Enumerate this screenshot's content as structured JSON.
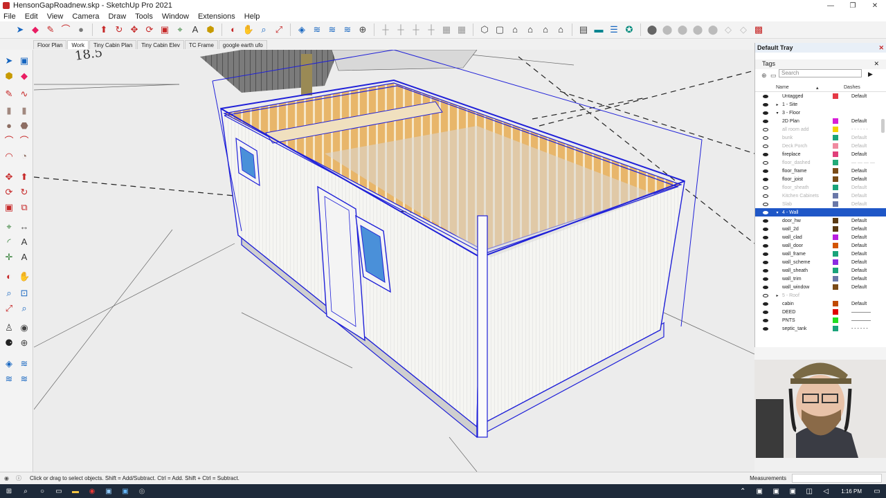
{
  "window": {
    "title": "HensonGapRoadnew.skp - SketchUp Pro 2021",
    "minimize_glyph": "—",
    "restore_glyph": "❐",
    "close_glyph": "✕"
  },
  "menu": [
    "File",
    "Edit",
    "View",
    "Camera",
    "Draw",
    "Tools",
    "Window",
    "Extensions",
    "Help"
  ],
  "scene_tabs": [
    {
      "label": "Floor Plan",
      "active": false
    },
    {
      "label": "Work",
      "active": true
    },
    {
      "label": "Tiny Cabin Plan",
      "active": false
    },
    {
      "label": "Tiny Cabin Elev",
      "active": false
    },
    {
      "label": "TC Frame",
      "active": false
    },
    {
      "label": "google earth ufo",
      "active": false
    }
  ],
  "tray": {
    "title": "Default Tray",
    "close_glyph": "✕",
    "tags_title": "Tags",
    "search_placeholder": "Search",
    "col_name": "Name",
    "col_dashes": "Dashes",
    "tags": [
      {
        "name": "Untagged",
        "color": "#e53945",
        "dashes": "Default",
        "visible": true,
        "tri": ""
      },
      {
        "name": "1 - Site",
        "color": "",
        "dashes": "",
        "visible": true,
        "tri": "▸"
      },
      {
        "name": "3 - Floor",
        "color": "",
        "dashes": "",
        "visible": true,
        "tri": "▾"
      },
      {
        "name": "2D Plan",
        "color": "#d81ed8",
        "dashes": "Default",
        "visible": true,
        "tri": ""
      },
      {
        "name": "all room add",
        "color": "#f4d200",
        "dashes": "- - - - - -",
        "visible": false,
        "tri": ""
      },
      {
        "name": "bunk",
        "color": "#1aa37a",
        "dashes": "Default",
        "visible": false,
        "tri": ""
      },
      {
        "name": "Deck Porch",
        "color": "#f08aa0",
        "dashes": "Default",
        "visible": false,
        "tri": ""
      },
      {
        "name": "fireplace",
        "color": "#e0407a",
        "dashes": "Default",
        "visible": true,
        "tri": ""
      },
      {
        "name": "floor_dashed",
        "color": "#22aa77",
        "dashes": "— — — —",
        "visible": false,
        "tri": ""
      },
      {
        "name": "floor_frame",
        "color": "#7a4b16",
        "dashes": "Default",
        "visible": true,
        "tri": ""
      },
      {
        "name": "floor_joist",
        "color": "#7a4b16",
        "dashes": "Default",
        "visible": true,
        "tri": ""
      },
      {
        "name": "floor_sheath",
        "color": "#1aa37a",
        "dashes": "Default",
        "visible": false,
        "tri": ""
      },
      {
        "name": "Kitchen Cabinets",
        "color": "#6a78a8",
        "dashes": "Default",
        "visible": false,
        "tri": ""
      },
      {
        "name": "Slab",
        "color": "#6a78a8",
        "dashes": "Default",
        "visible": false,
        "tri": ""
      },
      {
        "name": "4 - Wall",
        "color": "",
        "dashes": "",
        "visible": true,
        "tri": "▾",
        "selected": true
      },
      {
        "name": "door_hw",
        "color": "#5a3a12",
        "dashes": "Default",
        "visible": true,
        "tri": ""
      },
      {
        "name": "wall_2d",
        "color": "#5a3a12",
        "dashes": "Default",
        "visible": true,
        "tri": ""
      },
      {
        "name": "wall_clad",
        "color": "#b81ee0",
        "dashes": "Default",
        "visible": true,
        "tri": ""
      },
      {
        "name": "wall_door",
        "color": "#d35400",
        "dashes": "Default",
        "visible": true,
        "tri": ""
      },
      {
        "name": "wall_frame",
        "color": "#1aa37a",
        "dashes": "Default",
        "visible": true,
        "tri": ""
      },
      {
        "name": "wall_scheme",
        "color": "#8a2be2",
        "dashes": "Default",
        "visible": true,
        "tri": ""
      },
      {
        "name": "wall_sheath",
        "color": "#1aa37a",
        "dashes": "Default",
        "visible": true,
        "tri": ""
      },
      {
        "name": "wall_trim",
        "color": "#6a78a8",
        "dashes": "Default",
        "visible": true,
        "tri": ""
      },
      {
        "name": "wall_window",
        "color": "#7a4b16",
        "dashes": "Default",
        "visible": true,
        "tri": ""
      },
      {
        "name": "5 - Roof",
        "color": "",
        "dashes": "",
        "visible": false,
        "tri": "▸"
      },
      {
        "name": "cabin",
        "color": "#c04a00",
        "dashes": "Default",
        "visible": true,
        "tri": ""
      },
      {
        "name": "DEED",
        "color": "#e00000",
        "dashes": "————",
        "visible": true,
        "tri": ""
      },
      {
        "name": "PNTS",
        "color": "#22dd22",
        "dashes": "————",
        "visible": true,
        "tri": ""
      },
      {
        "name": "septic_tank",
        "color": "#1aa37a",
        "dashes": "- - - - - -",
        "visible": true,
        "tri": ""
      }
    ]
  },
  "status": {
    "hint": "Click or drag to select objects. Shift = Add/Subtract. Ctrl = Add. Shift + Ctrl = Subtract.",
    "measurements_label": "Measurements"
  },
  "taskbar": {
    "time": "1:16 PM"
  },
  "colors": {
    "selection_blue": "#1f20d8",
    "stud_wood": "#e8b66a",
    "siding": "#f5f5f2"
  }
}
